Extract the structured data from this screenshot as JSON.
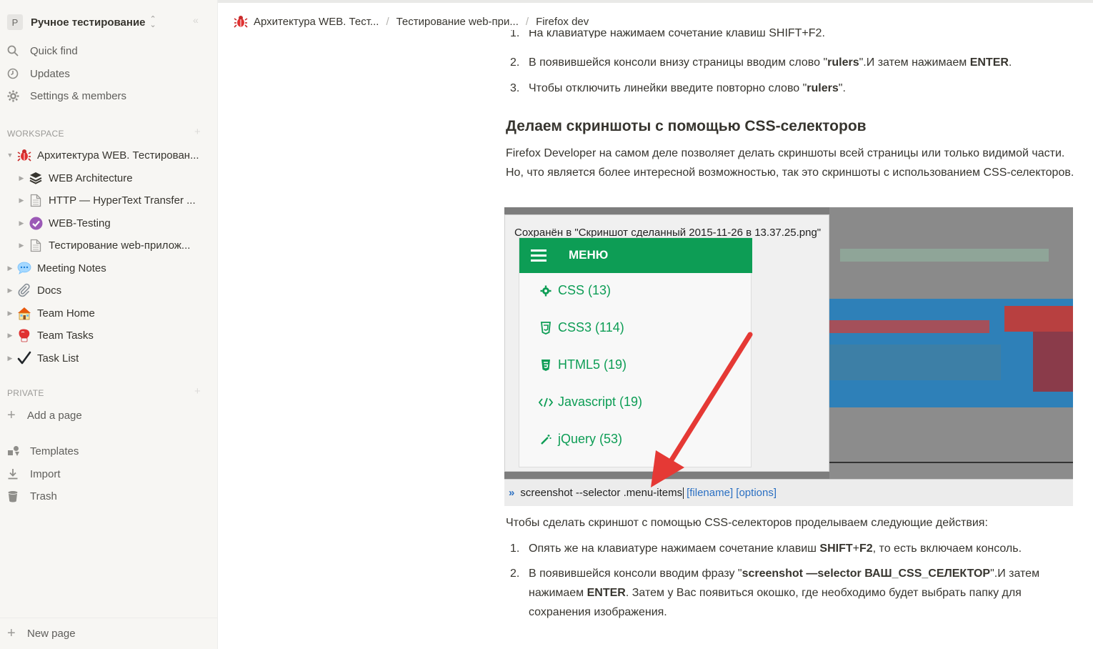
{
  "workspace": {
    "avatar": "P",
    "name": "Ручное тестирование"
  },
  "nav": {
    "quick_find": "Quick find",
    "updates": "Updates",
    "settings": "Settings & members"
  },
  "sections": {
    "workspace": "WORKSPACE",
    "private": "PRIVATE"
  },
  "tree": {
    "root": "Архитектура WEB. Тестирован...",
    "web_architecture": "WEB Architecture",
    "http": "HTTP — HyperText Transfer ...",
    "web_testing": "WEB-Testing",
    "testing_web": "Тестирование web-прилож...",
    "meeting_notes": "Meeting Notes",
    "docs": "Docs",
    "team_home": "Team Home",
    "team_tasks": "Team Tasks",
    "task_list": "Task List"
  },
  "private": {
    "add_page": "Add a page"
  },
  "tools": {
    "templates": "Templates",
    "import": "Import",
    "trash": "Trash"
  },
  "new_page": "New page",
  "breadcrumb": {
    "item1": "Архитектура WEB. Тест...",
    "item2": "Тестирование web-при...",
    "item3": "Firefox dev"
  },
  "content": {
    "list_top": {
      "item1_num": "1.",
      "item1_text": "На клавиатуре нажимаем сочетание клавиш SHIFT+F2.",
      "item2_num": "2.",
      "item2_pre": "В появившейся консоли внизу страницы вводим слово \"",
      "item2_bold": "rulers",
      "item2_mid": "\".И затем нажимаем ",
      "item2_bold2": "ENTER",
      "item2_post": ".",
      "item3_num": "3.",
      "item3_pre": "Чтобы отключить линейки введите повторно слово \"",
      "item3_bold": "rulers",
      "item3_post": "\"."
    },
    "heading": "Делаем скриншоты с помощью CSS-селекторов",
    "paragraph": "Firefox Developer на самом деле позволяет делать скриншоты всей страницы или только видимой части. Но, что является более интересной возможностью, так это скриншоты с использованием CSS-селекторов.",
    "screenshot": {
      "saved_text": "Сохранён в \"Скриншот сделанный 2015-11-26 в 13.37.25.png\"",
      "menu_title": "МЕНЮ",
      "menu_items": [
        "CSS (13)",
        "CSS3 (114)",
        "HTML5 (19)",
        "Javascript (19)",
        "jQuery (53)"
      ],
      "console_cmd": "screenshot --selector .menu-items",
      "console_hint": "[filename] [options]"
    },
    "after_image": "Чтобы сделать скриншот с помощью CSS-селекторов проделываем следующие действия:",
    "list_bottom": {
      "item1_num": "1.",
      "item1_pre": "Опять же на клавиатуре нажимаем сочетание клавиш ",
      "item1_bold": "SHIFT",
      "item1_mid": "+",
      "item1_bold2": "F2",
      "item1_post": ", то есть включаем консоль.",
      "item2_num": "2.",
      "item2_pre": "В появившейся консоли вводим фразу \"",
      "item2_bold": "screenshot —selector ВАШ_CSS_СЕЛЕКТОР",
      "item2_mid": "\".И затем нажимаем ",
      "item2_bold2": "ENTER",
      "item2_post": ". Затем у Вас появиться окошко, где необходимо будет выбрать папку для сохранения изображения."
    }
  },
  "colors": {
    "menu_green": "#0d9d55",
    "arrow_red": "#e53935",
    "console_blue": "#2a6fc2"
  }
}
